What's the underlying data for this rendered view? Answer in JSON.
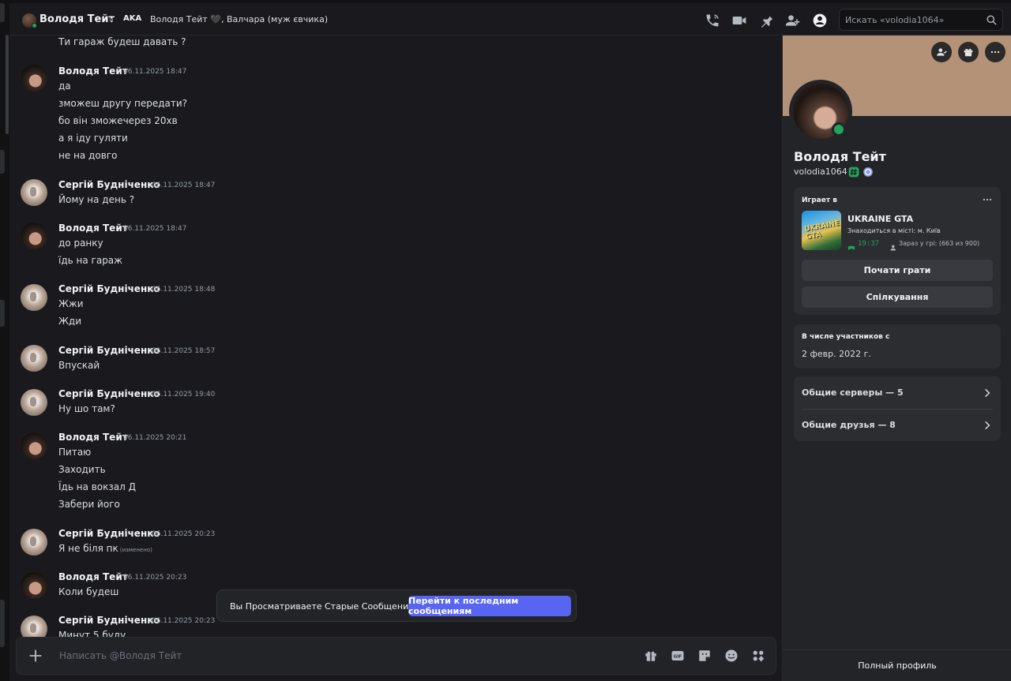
{
  "header": {
    "name": "Володя Тейт",
    "aka_label": "AKA",
    "aka_value": "Володя Тейт 🖤, Валчара (муж євчика)",
    "search_placeholder": "Искать «volodia1064»"
  },
  "messages": [
    {
      "author": null,
      "time": null,
      "lines": [
        "Ти гараж будеш давать ?"
      ]
    },
    {
      "author": "Володя Тейт",
      "time": "06.11.2025 18:47",
      "lines": [
        "да",
        "зможеш другу передати?",
        "бо він зможечерез 20хв",
        "а я іду гуляти",
        "не на довго"
      ]
    },
    {
      "author": "Сергій Будніченко",
      "time": "06.11.2025 18:47",
      "lines": [
        "Йому на день ?"
      ]
    },
    {
      "author": "Володя Тейт",
      "time": "06.11.2025 18:47",
      "lines": [
        "до ранку",
        "їдь на гараж"
      ]
    },
    {
      "author": "Сергій Будніченко",
      "time": "06.11.2025 18:48",
      "lines": [
        "Жжи",
        "Жди"
      ]
    },
    {
      "author": "Сергій Будніченко",
      "time": "06.11.2025 18:57",
      "lines": [
        "Впускай"
      ]
    },
    {
      "author": "Сергій Будніченко",
      "time": "06.11.2025 19:40",
      "lines": [
        "Ну шо там?"
      ]
    },
    {
      "author": "Володя Тейт",
      "time": "06.11.2025 20:21",
      "lines": [
        "Питаю",
        "Заходить",
        "Їдь на вокзал Д",
        "Забери його"
      ]
    },
    {
      "author": "Сергій Будніченко",
      "time": "06.11.2025 20:23",
      "lines": [
        "Я не біля пк"
      ],
      "edited": "(изменено)"
    },
    {
      "author": "Володя Тейт",
      "time": "06.11.2025 20:23",
      "lines": [
        "Коли будеш"
      ]
    },
    {
      "author": "Сергій Будніченко",
      "time": "06.11.2025 20:23",
      "lines": [
        "Минут 5 буду"
      ]
    }
  ],
  "jump_banner": {
    "text": "Вы Просматриваете Старые Сообщения",
    "button": "Перейти к последним сообщениям"
  },
  "composer": {
    "placeholder": "Написать @Володя Тейт",
    "gif_label": "GIF"
  },
  "profile": {
    "display_name": "Володя Тейт",
    "username": "volodia1064",
    "playing_title": "Играет в",
    "game_thumb_text": "UKRAINE GTA",
    "game_name": "UKRAINE GTA",
    "game_details": "Знаходиться в місті: м. Київ",
    "game_elapsed": "19:37",
    "game_party": "Зараз у грі: (663 из 900)",
    "play_button": "Почати грати",
    "chat_button": "Спілкування",
    "member_since_title": "В числе участников с",
    "member_since_value": "2 февр. 2022 г.",
    "mutual_servers": "Общие серверы — 5",
    "mutual_friends": "Общие друзья — 8",
    "full_profile": "Полный профиль"
  },
  "colors": {
    "accent": "#5865f2",
    "online": "#23a559",
    "banner": "#b39278"
  }
}
